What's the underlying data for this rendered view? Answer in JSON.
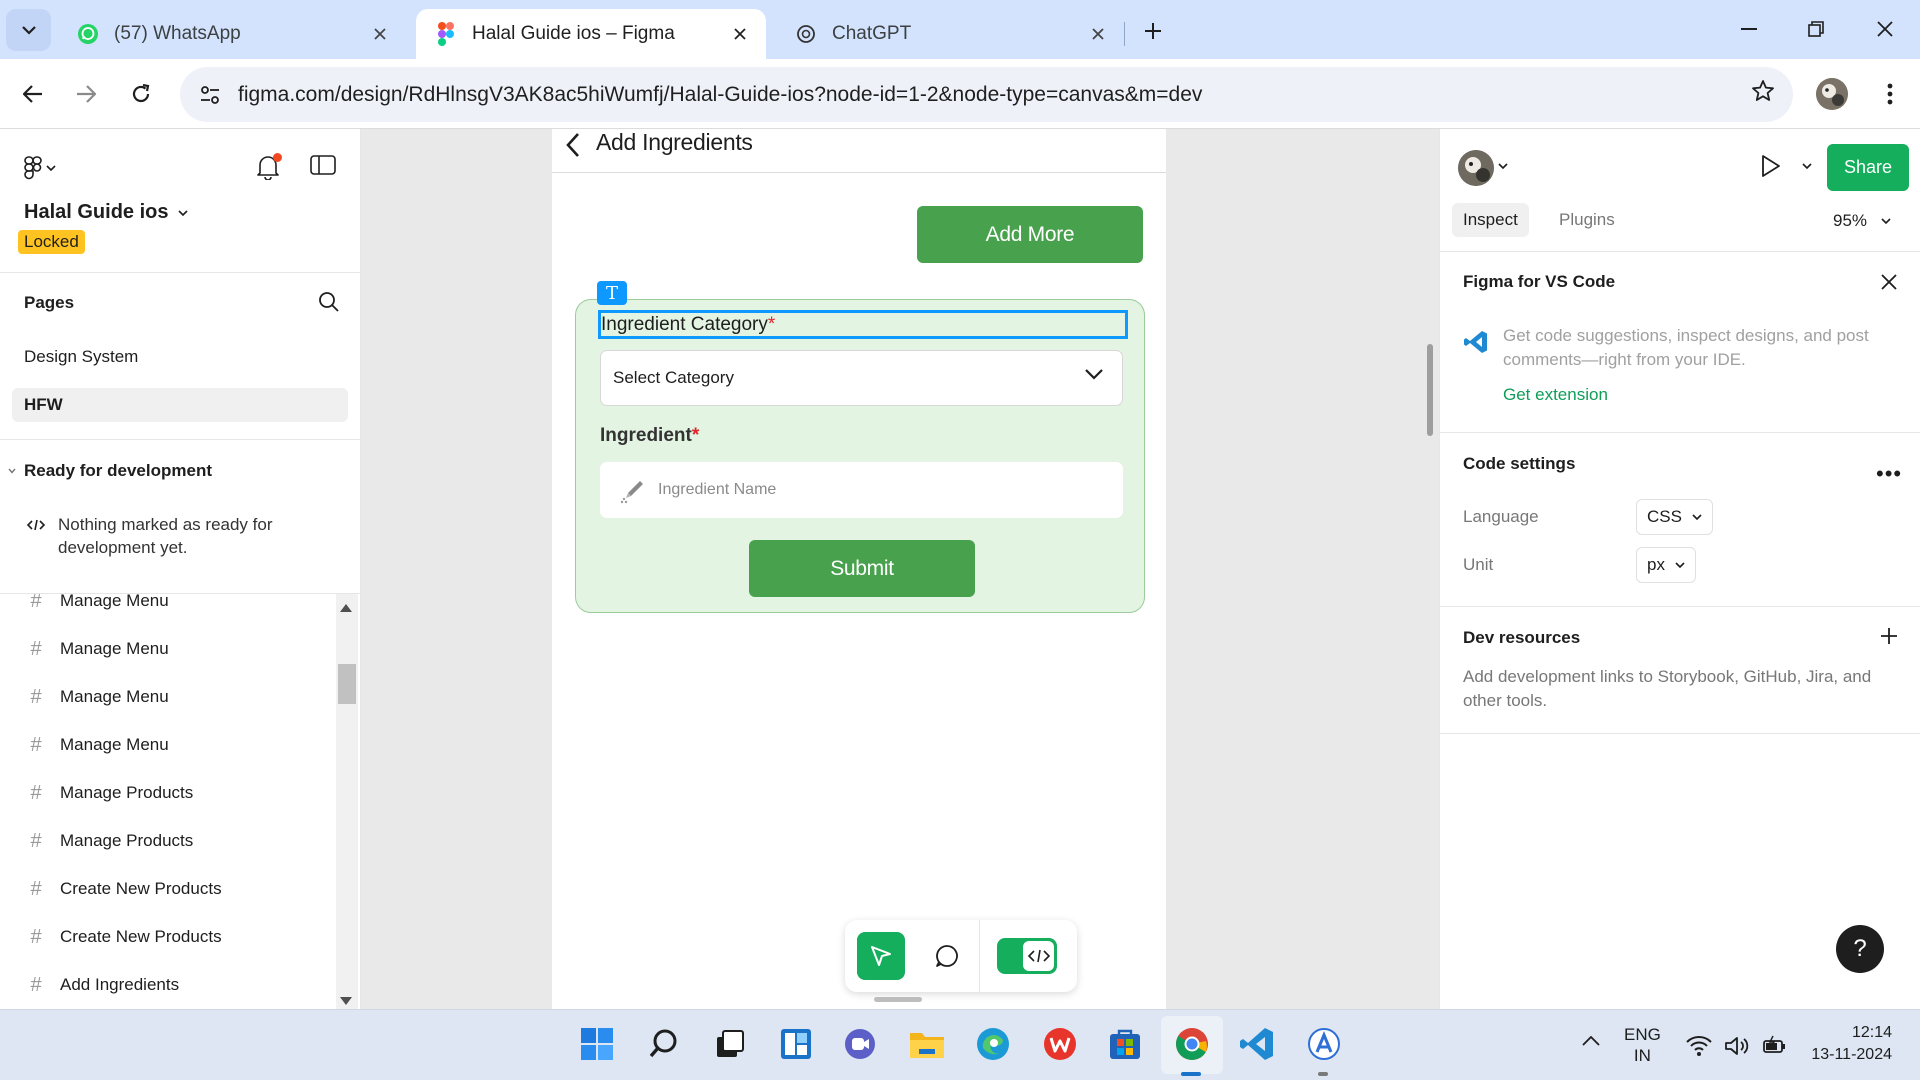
{
  "browser": {
    "tabs": [
      {
        "title": "(57) WhatsApp",
        "favicon": "whatsapp-icon",
        "active": false
      },
      {
        "title": "Halal Guide ios – Figma",
        "favicon": "figma-icon",
        "active": true
      },
      {
        "title": "ChatGPT",
        "favicon": "chatgpt-icon",
        "active": false
      }
    ],
    "url": "figma.com/design/RdHlnsgV3AK8ac5hiWumfj/Halal-Guide-ios?node-id=1-2&node-type=canvas&m=dev"
  },
  "left_panel": {
    "file_name": "Halal Guide ios",
    "locked_badge": "Locked",
    "pages_title": "Pages",
    "pages": [
      {
        "label": "Design System",
        "selected": false
      },
      {
        "label": "HFW",
        "selected": true
      }
    ],
    "ready_section_title": "Ready for development",
    "ready_empty_text": "Nothing marked as ready for development yet.",
    "frames": [
      "Manage Menu",
      "Manage Menu",
      "Manage Menu",
      "Manage Menu",
      "Manage Products",
      "Manage Products",
      "Create New Products",
      "Create New Products",
      "Add Ingredients"
    ]
  },
  "canvas": {
    "frame_title": "Add Ingredients",
    "add_more_label": "Add More",
    "text_tool_glyph": "T",
    "category_label": "Ingredient Category",
    "required_mark": "*",
    "category_placeholder": "Select Category",
    "ingredient_label": "Ingredient",
    "ingredient_placeholder": "Ingredient Name",
    "submit_label": "Submit"
  },
  "right_panel": {
    "share_label": "Share",
    "tabs": [
      {
        "label": "Inspect",
        "active": true
      },
      {
        "label": "Plugins",
        "active": false
      }
    ],
    "zoom": "95%",
    "vscode": {
      "title": "Figma for VS Code",
      "description": "Get code suggestions, inspect designs, and post comments—right from your IDE.",
      "link": "Get extension"
    },
    "code_settings": {
      "title": "Code settings",
      "language_label": "Language",
      "language_value": "CSS",
      "unit_label": "Unit",
      "unit_value": "px"
    },
    "dev_resources": {
      "title": "Dev resources",
      "description": "Add development links to Storybook, GitHub, Jira, and other tools."
    },
    "help_glyph": "?"
  },
  "taskbar": {
    "apps": [
      "windows-start-icon",
      "search-icon",
      "task-view-icon",
      "widgets-icon",
      "teams-chat-icon",
      "file-explorer-icon",
      "edge-icon",
      "wps-office-icon",
      "microsoft-store-icon",
      "chrome-icon",
      "vscode-icon",
      "app-icon"
    ],
    "lang_top": "ENG",
    "lang_bottom": "IN",
    "time": "12:14",
    "date": "13-11-2024"
  },
  "colors": {
    "accent_green": "#48a14d",
    "figma_green": "#14ae5c",
    "selection_blue": "#0d99ff",
    "card_bg": "#e3f4e3",
    "locked_yellow": "#ffc321"
  }
}
